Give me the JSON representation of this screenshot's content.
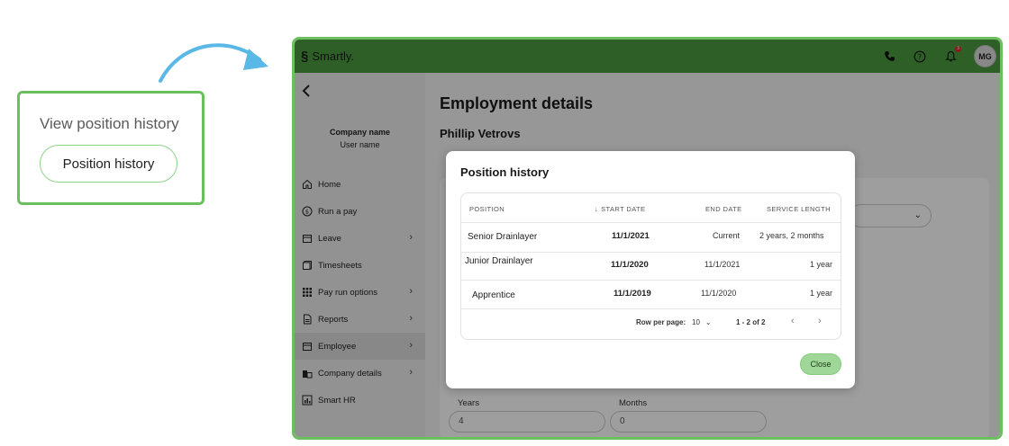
{
  "callout": {
    "title": "View position history",
    "button_label": "Position history"
  },
  "topbar": {
    "brand": "Smartly.",
    "notification_count": "3",
    "avatar_initials": "MG",
    "icons": [
      "phone-icon",
      "help-icon",
      "bell-icon"
    ]
  },
  "sidebar": {
    "company_name": "Company name",
    "user_name": "User name",
    "items": [
      {
        "label": "Home",
        "icon": "home-icon",
        "chevron": false
      },
      {
        "label": "Run a pay",
        "icon": "dollar-icon",
        "chevron": false
      },
      {
        "label": "Leave",
        "icon": "calendar-icon",
        "chevron": true
      },
      {
        "label": "Timesheets",
        "icon": "timesheet-icon",
        "chevron": false
      },
      {
        "label": "Pay run options",
        "icon": "grid-icon",
        "chevron": true
      },
      {
        "label": "Reports",
        "icon": "report-icon",
        "chevron": true
      },
      {
        "label": "Employee",
        "icon": "calendar-icon",
        "chevron": true,
        "active": true
      },
      {
        "label": "Company details",
        "icon": "company-icon",
        "chevron": true
      },
      {
        "label": "Smart HR",
        "icon": "chart-icon",
        "chevron": false
      }
    ]
  },
  "main": {
    "page_title": "Employment details",
    "employee_name": "Phillip Vetrovs",
    "years_label": "Years",
    "years_value": "4",
    "months_label": "Months",
    "months_value": "0"
  },
  "modal": {
    "title": "Position history",
    "columns": [
      "POSITION",
      "START DATE",
      "END DATE",
      "SERVICE LENGTH"
    ],
    "rows": [
      {
        "position": "Senior Drainlayer",
        "start": "11/1/2021",
        "end": "Current",
        "length": "2 years, 2 months"
      },
      {
        "position": "Junior Drainlayer",
        "start": "11/1/2020",
        "end": "11/1/2021",
        "length": "1 year"
      },
      {
        "position": "Apprentice",
        "start": "11/1/2019",
        "end": "11/1/2020",
        "length": "1 year"
      }
    ],
    "rows_per_page_label": "Row per page:",
    "rows_per_page_value": "10",
    "range_text": "1 - 2 of 2",
    "close_label": "Close"
  },
  "colors": {
    "accent_green": "#6cbf5f",
    "topbar_green": "#4a9a3e",
    "close_button": "#9ed797",
    "arrow_blue": "#5ab8e6"
  }
}
